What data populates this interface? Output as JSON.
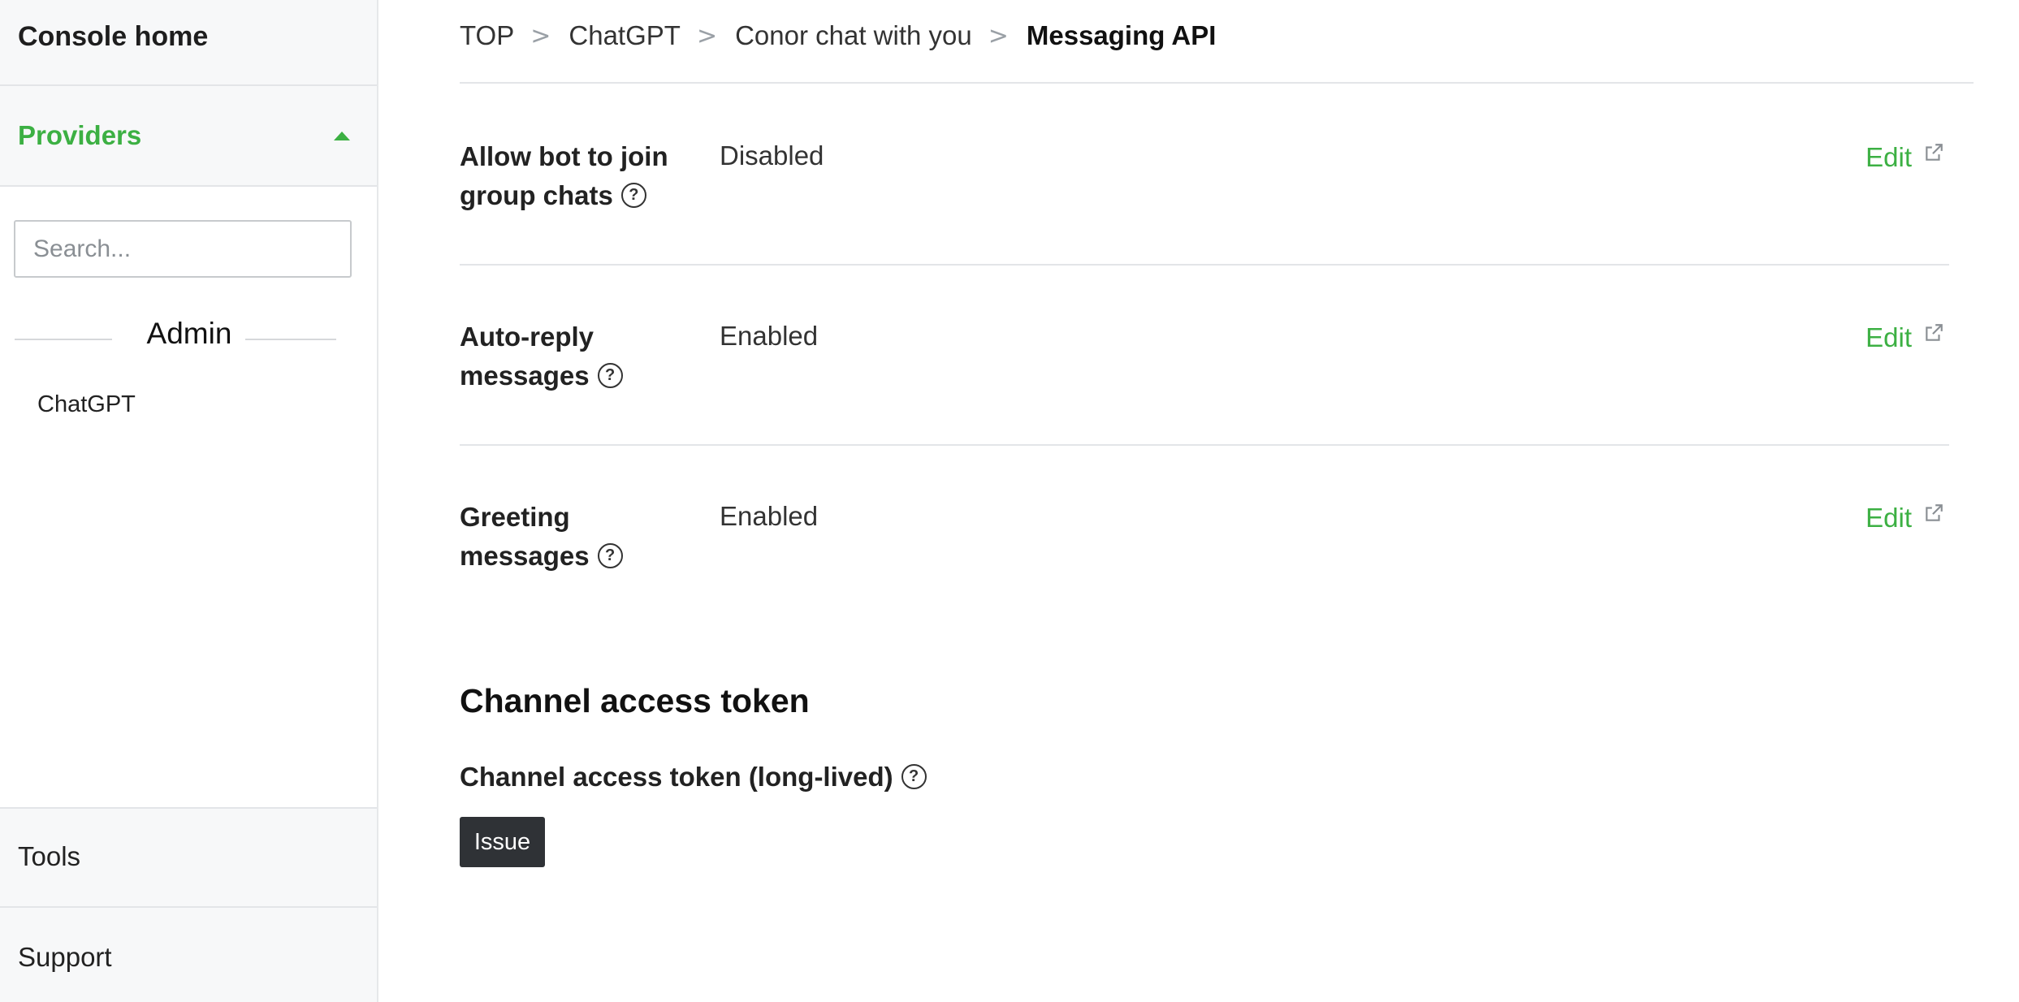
{
  "sidebar": {
    "home": "Console home",
    "providers": "Providers",
    "search_placeholder": "Search...",
    "section": "Admin",
    "items": [
      {
        "label": "ChatGPT"
      }
    ],
    "tools": "Tools",
    "support": "Support"
  },
  "breadcrumb": {
    "items": [
      "TOP",
      "ChatGPT",
      "Conor chat with you"
    ],
    "current": "Messaging API",
    "separator": ">"
  },
  "settings": [
    {
      "label": "Allow bot to join group chats",
      "value": "Disabled",
      "action": "Edit"
    },
    {
      "label": "Auto-reply messages",
      "value": "Enabled",
      "action": "Edit"
    },
    {
      "label": "Greeting messages",
      "value": "Enabled",
      "action": "Edit"
    }
  ],
  "token_section": {
    "title": "Channel access token",
    "label": "Channel access token (long-lived)",
    "button": "Issue"
  },
  "help_glyph": "?",
  "colors": {
    "accent": "#3cb043",
    "button_bg": "#2f3236",
    "sidebar_bg": "#f7f8f9"
  }
}
